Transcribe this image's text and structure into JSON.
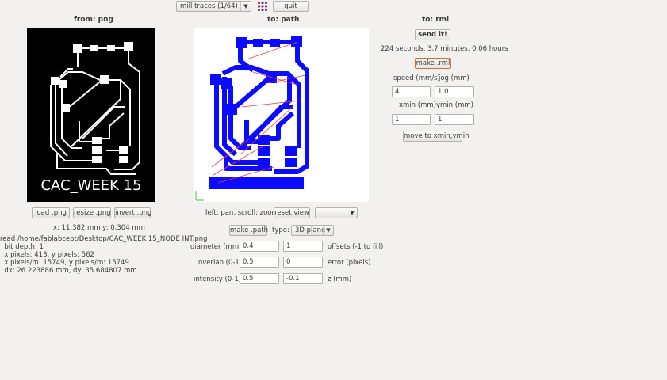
{
  "toolbar": {
    "process_value": "mill traces (1/64)",
    "quit_label": "quit",
    "grid_icon": "grid-dots-icon"
  },
  "from_png": {
    "title": "from: png",
    "board_text": "CAC_WEEK 15",
    "load_label": "load .png",
    "resize_label": "resize .png",
    "invert_label": "invert .png",
    "coords": "x: 11.382 mm  y: 0.304 mm",
    "info_lines": [
      "read /home/fablabcept/Desktop/CAC_WEEK 15_NODE INT.png",
      "  bit depth: 1",
      "  x pixels: 413, y pixels: 562",
      "  x pixels/m: 15749, y pixels/m: 15749",
      "  dx: 26.223886 mm, dy: 35.684807 mm"
    ]
  },
  "to_path": {
    "title": "to: path",
    "hint": "left: pan, scroll: zoom",
    "reset_label": "reset view",
    "view_value": "",
    "make_label": "make .path",
    "type_label": "type:",
    "type_value": "3D plane",
    "diameter_label": "diameter (mm)",
    "diameter_value": "0.4",
    "offsets_value": "1",
    "offsets_label": "offsets (-1 to fill)",
    "overlap_label": "overlap (0-1)",
    "overlap_value": "0.5",
    "error_value": "0",
    "error_label": "error (pixels)",
    "intensity_label": "intensity (0-1)",
    "intensity_value": "0.5",
    "z_value": "-0.1",
    "z_label": "z (mm)",
    "path_color": "#0b0bff",
    "move_color": "#ff3333"
  },
  "to_rml": {
    "title": "to: rml",
    "send_label": "send it!",
    "estimate": "224 seconds, 3.7 minutes, 0.06 hours",
    "make_label": "make .rml",
    "speed_label": "speed (mm/s)",
    "jog_label": "jog (mm)",
    "speed_value": "4",
    "jog_value": "1.0",
    "xmin_label": "xmin (mm)",
    "ymin_label": "ymin (mm)",
    "xmin_value": "1",
    "ymin_value": "1",
    "move_label": "move to xmin,ymin"
  }
}
